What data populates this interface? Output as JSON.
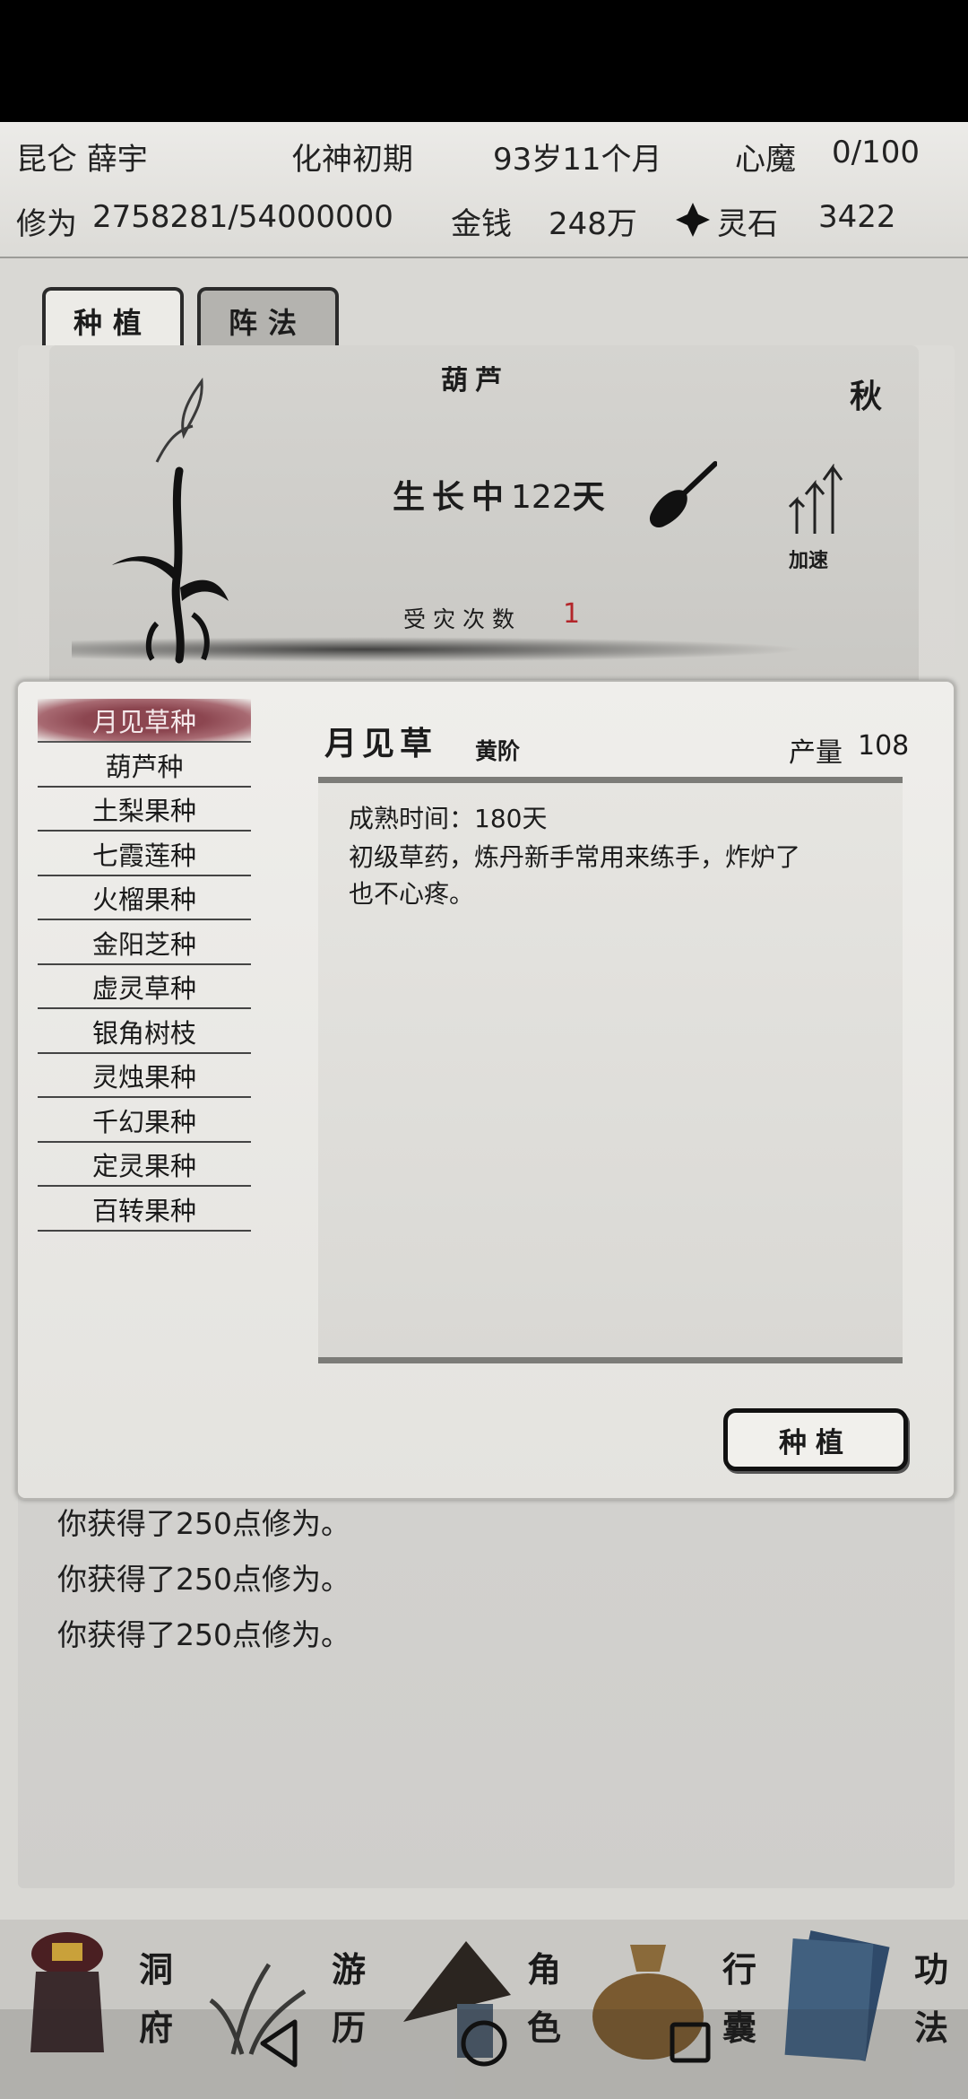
{
  "header": {
    "name": "昆仑 薛宇",
    "realm": "化神初期",
    "age": "93岁11个月",
    "demon_label": "心魔",
    "demon_value": "0/100",
    "cultivation_label": "修为",
    "cultivation_value": "2758281/54000000",
    "money_label": "金钱",
    "money_value": "248万",
    "spirit_stone_label": "灵石",
    "spirit_stone_value": "3422"
  },
  "tabs": [
    {
      "label": "种植"
    },
    {
      "label": "阵法"
    }
  ],
  "farm": {
    "crop_name": "葫芦",
    "season": "秋",
    "status": "生长中",
    "days": "122",
    "days_unit": "天",
    "speedup_label": "加速",
    "disaster_label": "受灾次数",
    "disaster_count": "1"
  },
  "dialog": {
    "seeds": [
      {
        "label": "月见草种",
        "selected": true
      },
      {
        "label": "葫芦种"
      },
      {
        "label": "土梨果种"
      },
      {
        "label": "七霞莲种"
      },
      {
        "label": "火榴果种"
      },
      {
        "label": "金阳芝种"
      },
      {
        "label": "虚灵草种"
      },
      {
        "label": "银角树枝"
      },
      {
        "label": "灵烛果种"
      },
      {
        "label": "千幻果种"
      },
      {
        "label": "定灵果种"
      },
      {
        "label": "百转果种"
      }
    ],
    "selected_name": "月见草",
    "grade": "黄阶",
    "yield_label": "产量",
    "yield_value": "108",
    "mature_line": "成熟时间：180天",
    "description_line1": "初级草药，炼丹新手常用来练手，炸炉了",
    "description_line2": "也不心疼。",
    "plant_button": "种植"
  },
  "log": [
    "你获得了250点修为。",
    "你获得了250点修为。",
    "你获得了250点修为。"
  ],
  "nav": [
    {
      "top": "洞",
      "bottom": "府",
      "icon": "cave-mansion-icon"
    },
    {
      "top": "游",
      "bottom": "历",
      "icon": "travel-icon"
    },
    {
      "top": "角",
      "bottom": "色",
      "icon": "character-icon"
    },
    {
      "top": "行",
      "bottom": "囊",
      "icon": "bag-icon"
    },
    {
      "top": "功",
      "bottom": "法",
      "icon": "technique-book-icon"
    }
  ],
  "system_nav": [
    "back-icon",
    "home-icon",
    "recents-icon"
  ],
  "colors": {
    "accent_red": "#b3262a",
    "selected_item": "#8c4650",
    "ink": "#1c1c1c"
  }
}
